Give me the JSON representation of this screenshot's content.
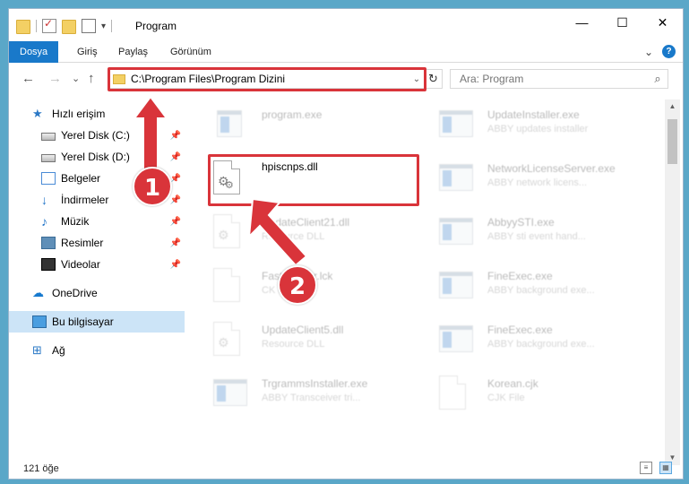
{
  "window": {
    "title": "Program",
    "controls": {
      "minimize": "—",
      "maximize": "☐",
      "close": "✕"
    }
  },
  "ribbon": {
    "tabs": [
      "Dosya",
      "Giriş",
      "Paylaş",
      "Görünüm"
    ],
    "active_tab": "Dosya",
    "expand_icon": "⌄",
    "help_icon": "?"
  },
  "nav": {
    "back": "←",
    "forward": "→",
    "recent": "⌄",
    "up": "↑",
    "address": "C:\\Program Files\\Program Dizini",
    "address_dropdown": "⌄",
    "refresh": "↻",
    "search_placeholder": "Ara: Program",
    "search_icon": "⌕"
  },
  "sidebar": {
    "items": [
      {
        "label": "Hızlı erişim",
        "icon": "star-icon",
        "pinned": false
      },
      {
        "label": "Yerel Disk (C:)",
        "icon": "disk-icon",
        "pinned": true
      },
      {
        "label": "Yerel Disk (D:)",
        "icon": "disk-icon",
        "pinned": true
      },
      {
        "label": "Belgeler",
        "icon": "documents-icon",
        "pinned": true
      },
      {
        "label": "İndirmeler",
        "icon": "download-icon",
        "pinned": true
      },
      {
        "label": "Müzik",
        "icon": "music-icon",
        "pinned": true
      },
      {
        "label": "Resimler",
        "icon": "pictures-icon",
        "pinned": true
      },
      {
        "label": "Videolar",
        "icon": "videos-icon",
        "pinned": true
      },
      {
        "label": "OneDrive",
        "icon": "cloud-icon",
        "pinned": false
      },
      {
        "label": "Bu bilgisayar",
        "icon": "computer-icon",
        "pinned": false,
        "selected": true
      },
      {
        "label": "Ağ",
        "icon": "network-icon",
        "pinned": false
      }
    ],
    "pin_glyph": "📌"
  },
  "files": {
    "left": [
      {
        "name": "program.exe",
        "desc": "",
        "icon": "installer-icon",
        "faded": true
      },
      {
        "name": "hpiscnps.dll",
        "desc": "",
        "icon": "dll-icon",
        "faded": false
      },
      {
        "name": "UpdateClient21.dll",
        "desc": "Resource DLL",
        "icon": "dll-icon",
        "faded": true
      },
      {
        "name": "FastKeeper.lck",
        "desc": "CK File",
        "icon": "file-icon",
        "faded": true
      },
      {
        "name": "UpdateClient5.dll",
        "desc": "Resource DLL",
        "icon": "dll-icon",
        "faded": true
      },
      {
        "name": "TrgrammsInstaller.exe",
        "desc": "ABBY Transceiver tri...",
        "icon": "exe-icon",
        "faded": true
      }
    ],
    "right": [
      {
        "name": "UpdateInstaller.exe",
        "desc": "ABBY updates installer",
        "icon": "exe-icon",
        "faded": true
      },
      {
        "name": "NetworkLicenseServer.exe",
        "desc": "ABBY network licens...",
        "icon": "exe-icon",
        "faded": true
      },
      {
        "name": "AbbyySTI.exe",
        "desc": "ABBY sti event hand...",
        "icon": "exe-icon",
        "faded": true
      },
      {
        "name": "FineExec.exe",
        "desc": "ABBY background exe...",
        "icon": "exe-icon",
        "faded": true
      },
      {
        "name": "FineExec.exe",
        "desc": "ABBY background exe...",
        "icon": "exe-icon",
        "faded": true
      },
      {
        "name": "Korean.cjk",
        "desc": "CJK File",
        "icon": "file-icon",
        "faded": true
      }
    ]
  },
  "status": {
    "item_count": "121 öğe"
  },
  "callouts": {
    "one": "1",
    "two": "2"
  },
  "colors": {
    "accent": "#1979ca",
    "highlight": "#d9343a",
    "selection": "#cce4f7"
  }
}
